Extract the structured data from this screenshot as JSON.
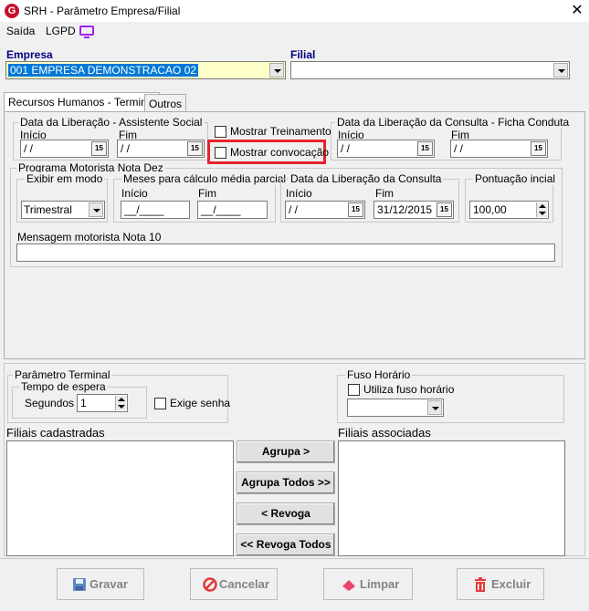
{
  "window": {
    "app_icon": "G",
    "title": "SRH - Parâmetro Empresa/Filial",
    "close": "✕"
  },
  "menu": [
    "Saída",
    "LGPD"
  ],
  "empresa": {
    "label": "Empresa",
    "value": "001 EMPRESA DEMONSTRACAO 02"
  },
  "filial": {
    "label": "Filial",
    "value": ""
  },
  "tabs": [
    "Recursos Humanos - Terminal",
    "Outros"
  ],
  "assistente_social": {
    "title": "Data da Liberação - Assistente Social",
    "inicio_label": "Início",
    "inicio_value": "/ /",
    "fim_label": "Fim",
    "fim_value": "/ /"
  },
  "checkboxes": {
    "mostrar_treinamento": "Mostrar Treinamento",
    "mostrar_convocacao": "Mostrar convocação"
  },
  "ficha_conduta": {
    "title": "Data da Liberação da Consulta  - Ficha Conduta",
    "inicio_label": "Início",
    "inicio_value": "/ /",
    "fim_label": "Fim",
    "fim_value": "/ /"
  },
  "motorista": {
    "title": "Programa Motorista Nota Dez",
    "exibir_title": "Exibir em modo",
    "exibir_value": "Trimestral",
    "meses_title": "Meses para cálculo média parcial",
    "meses_inicio_label": "Início",
    "meses_inicio_value": "__/____",
    "meses_fim_label": "Fim",
    "meses_fim_value": "__/____",
    "consulta_title": "Data da Liberação da Consulta",
    "consulta_inicio_label": "Início",
    "consulta_inicio_value": "/ /",
    "consulta_fim_label": "Fim",
    "consulta_fim_value": "31/12/2015",
    "pontuacao_title": "Pontuação incial",
    "pontuacao_value": "100,00",
    "mensagem_label": "Mensagem motorista Nota 10",
    "mensagem_value": ""
  },
  "terminal": {
    "title": "Parâmetro Terminal",
    "tempo_title": "Tempo de espera",
    "segundos_label": "Segundos",
    "segundos_value": "1",
    "exige_senha": "Exige senha"
  },
  "fuso": {
    "title": "Fuso Horário",
    "utiliza": "Utiliza fuso horário",
    "value": ""
  },
  "lists": {
    "cadastradas_label": "Filiais cadastradas",
    "associadas_label": "Filiais associadas"
  },
  "buttons": {
    "agrupa": "Agrupa >",
    "agrupa_todos": "Agrupa Todos >>",
    "revoga": "< Revoga",
    "revoga_todos": "<< Revoga Todos"
  },
  "calendar_glyph": "15",
  "footer": {
    "gravar": "Gravar",
    "cancelar": "Cancelar",
    "limpar": "Limpar",
    "excluir": "Excluir"
  },
  "colors": {
    "highlight": "#e8232b",
    "selection": "#0078d7",
    "label_blue": "#000080"
  }
}
